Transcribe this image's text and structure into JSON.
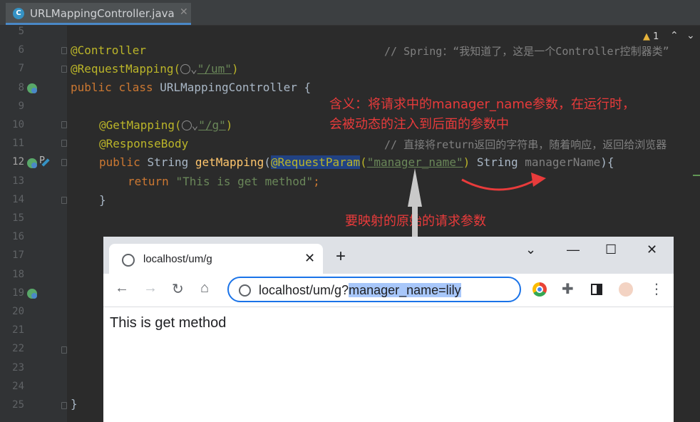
{
  "editor": {
    "tab_title": "URLMappingController.java",
    "tab_icon_letter": "C",
    "warning_count": "1",
    "line_numbers": [
      "5",
      "6",
      "7",
      "8",
      "9",
      "10",
      "11",
      "12",
      "13",
      "14",
      "15",
      "16",
      "17",
      "18",
      "19",
      "20",
      "21",
      "22",
      "23",
      "24",
      "25"
    ],
    "code": {
      "l6_annotation": "@Controller",
      "l6_comment": "// Spring：“我知道了，这是一个Controller控制器类”",
      "l7_annotation": "@RequestMapping(",
      "l7_value": "\"/um\"",
      "l7_close": ")",
      "l8_public": "public",
      "l8_class": "class",
      "l8_name": "URLMappingController {",
      "l10_annotation": "@GetMapping(",
      "l10_value": "\"/g\"",
      "l10_close": ")",
      "l11_annotation": "@ResponseBody",
      "l11_comment": "// 直接将return返回的字符串，随着响应，返回给浏览器",
      "l12_public": "public",
      "l12_type": "String",
      "l12_method": "getMapping",
      "l12_paren": "(",
      "l12_annotation": "@RequestParam",
      "l12_open": "(",
      "l12_param_name": "\"manager_name\"",
      "l12_close": ")",
      "l12_type2": "String",
      "l12_var": "managerName",
      "l12_end": "){",
      "l13_return": "return",
      "l13_string": "\"This is get method\"",
      "l13_semi": ";",
      "l14_brace": "}",
      "l25_brace": "}"
    }
  },
  "annotations": {
    "meaning_line1": "含义：将请求中的manager_name参数，在运行时，",
    "meaning_line2": "会被动态的注入到后面的参数中",
    "original_param": "要映射的原始的请求参数"
  },
  "browser": {
    "tab_title": "localhost/um/g",
    "url_base": "localhost/um/g?",
    "url_query": "manager_name=lily",
    "page_text": "This is get method"
  },
  "colors": {
    "annotation_red": "#e83b3b",
    "omnibox_blue": "#1a73e8"
  }
}
